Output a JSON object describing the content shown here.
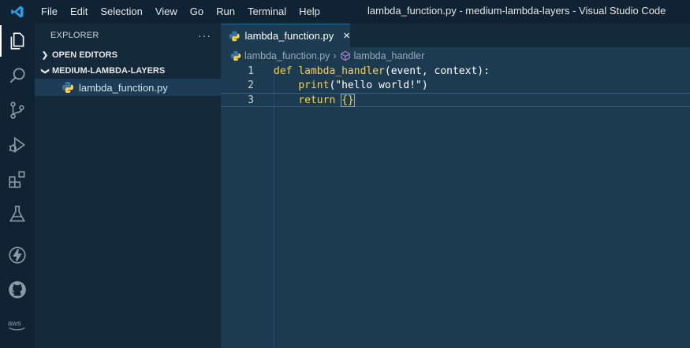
{
  "titlebar": {
    "menu": [
      "File",
      "Edit",
      "Selection",
      "View",
      "Go",
      "Run",
      "Terminal",
      "Help"
    ],
    "window_title": "lambda_function.py - medium-lambda-layers - Visual Studio Code"
  },
  "activity_bar": {
    "items": [
      "explorer-icon",
      "search-icon",
      "source-control-icon",
      "run-debug-icon",
      "extensions-icon",
      "testing-icon",
      "lightning-icon",
      "github-icon",
      "aws-icon"
    ]
  },
  "sidebar": {
    "title": "EXPLORER",
    "more": "···",
    "open_editors": "OPEN EDITORS",
    "folder": "MEDIUM-LAMBDA-LAYERS",
    "files": [
      "lambda_function.py"
    ]
  },
  "editor": {
    "tab_label": "lambda_function.py",
    "tab_close": "×",
    "breadcrumb": {
      "file": "lambda_function.py",
      "symbol": "lambda_handler"
    },
    "lines": [
      {
        "number": "1"
      },
      {
        "number": "2"
      },
      {
        "number": "3"
      }
    ],
    "code": {
      "l1_kw": "def",
      "l1_fn": "lambda_handler",
      "l1_rest": "(event, context):",
      "l2_indent": "    ",
      "l2_fn": "print",
      "l2_rest": "(\"hello world!\")",
      "l3_indent": "    ",
      "l3_kw": "return",
      "l3_rest": " ",
      "l3_brace": "{}"
    }
  },
  "colors": {
    "background": "#1c3b51",
    "sidebar": "#14293a",
    "titlebar": "#0f2334",
    "keyword": "#ffcf3f"
  }
}
